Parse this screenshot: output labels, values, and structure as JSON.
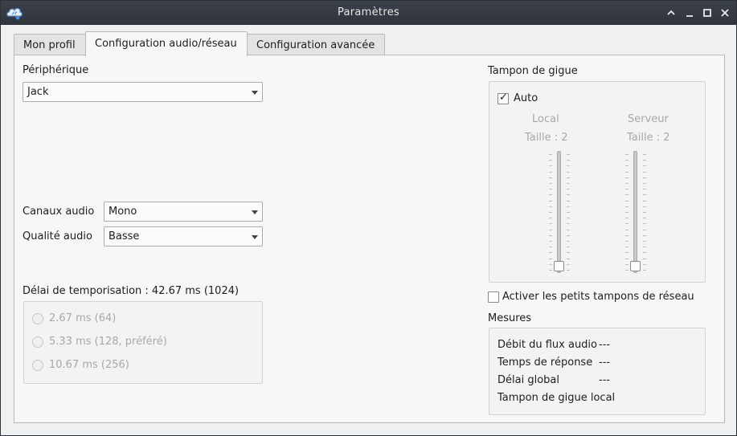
{
  "window": {
    "title": "Paramètres",
    "app_icon": "app-cloud-icon"
  },
  "tabs": [
    {
      "label": "Mon profil",
      "active": false
    },
    {
      "label": "Configuration audio/réseau",
      "active": true
    },
    {
      "label": "Configuration avancée",
      "active": false
    }
  ],
  "device": {
    "label": "Périphérique",
    "value": "Jack"
  },
  "audio_channels": {
    "label": "Canaux audio",
    "value": "Mono"
  },
  "audio_quality": {
    "label": "Qualité audio",
    "value": "Basse"
  },
  "buffer_delay": {
    "label": "Délai de temporisation : 42.67 ms (1024)",
    "options": [
      {
        "label": "2.67 ms (64)",
        "selected": false,
        "enabled": false
      },
      {
        "label": "5.33 ms (128, préféré)",
        "selected": false,
        "enabled": false
      },
      {
        "label": "10.67 ms (256)",
        "selected": false,
        "enabled": false
      }
    ]
  },
  "jitter_buffer": {
    "title": "Tampon de gigue",
    "auto_label": "Auto",
    "auto_checked": true,
    "auto_check_glyph": "✓",
    "local": {
      "label": "Local",
      "size_label": "Taille : 2",
      "level": 0.0
    },
    "server": {
      "label": "Serveur",
      "size_label": "Taille : 2",
      "level": 0.0
    }
  },
  "small_network_buffers": {
    "label": "Activer les petits tampons de réseau",
    "checked": false
  },
  "measures": {
    "title": "Mesures",
    "rows": [
      {
        "label": "Débit du flux audio",
        "value": "---"
      },
      {
        "label": "Temps de réponse",
        "value": "---"
      },
      {
        "label": "Délai global",
        "value": "---"
      },
      {
        "label": "Tampon de gigue local",
        "value": ""
      }
    ]
  },
  "colors": {
    "titlebar": "#30353d",
    "window_bg": "#f0f0f0",
    "disabled_text": "#a8a8a8"
  }
}
